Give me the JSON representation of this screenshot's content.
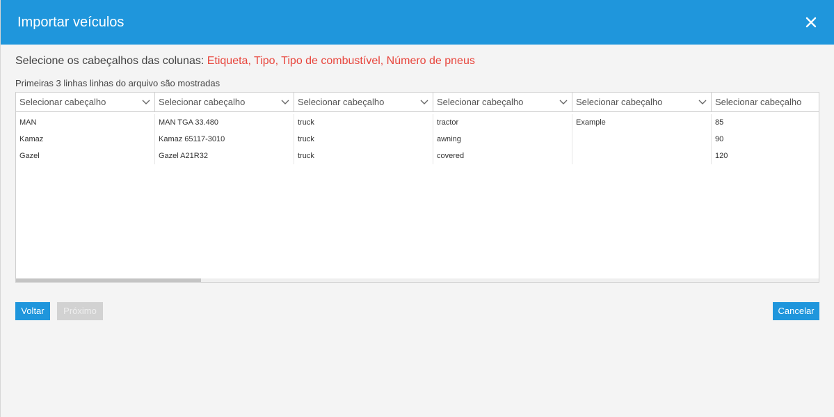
{
  "dialog": {
    "title": "Importar veículos",
    "close_icon": "close-icon"
  },
  "instruction": {
    "prefix": "Selecione os cabeçalhos das colunas: ",
    "required_columns": "Etiqueta, Tipo, Tipo de combustível, Número de pneus"
  },
  "note": "Primeiras 3 linhas linhas do arquivo são mostradas",
  "column_selects": [
    {
      "value": "Selecionar cabeçalho"
    },
    {
      "value": "Selecionar cabeçalho"
    },
    {
      "value": "Selecionar cabeçalho"
    },
    {
      "value": "Selecionar cabeçalho"
    },
    {
      "value": "Selecionar cabeçalho"
    },
    {
      "value": "Selecionar cabeçalho"
    }
  ],
  "rows": [
    [
      "MAN",
      "MAN TGA 33.480",
      "truck",
      "tractor",
      "Example",
      "85"
    ],
    [
      "Kamaz",
      "Kamaz 65117-3010",
      "truck",
      "awning",
      "",
      "90"
    ],
    [
      "Gazel",
      "Gazel A21R32",
      "truck",
      "covered",
      "",
      "120"
    ]
  ],
  "buttons": {
    "back": "Voltar",
    "next": "Próximo",
    "cancel": "Cancelar"
  },
  "colors": {
    "header_bg": "#1f96dc",
    "accent": "#1f96dc",
    "required_text": "#e8453c",
    "disabled": "#d2d2d2"
  }
}
